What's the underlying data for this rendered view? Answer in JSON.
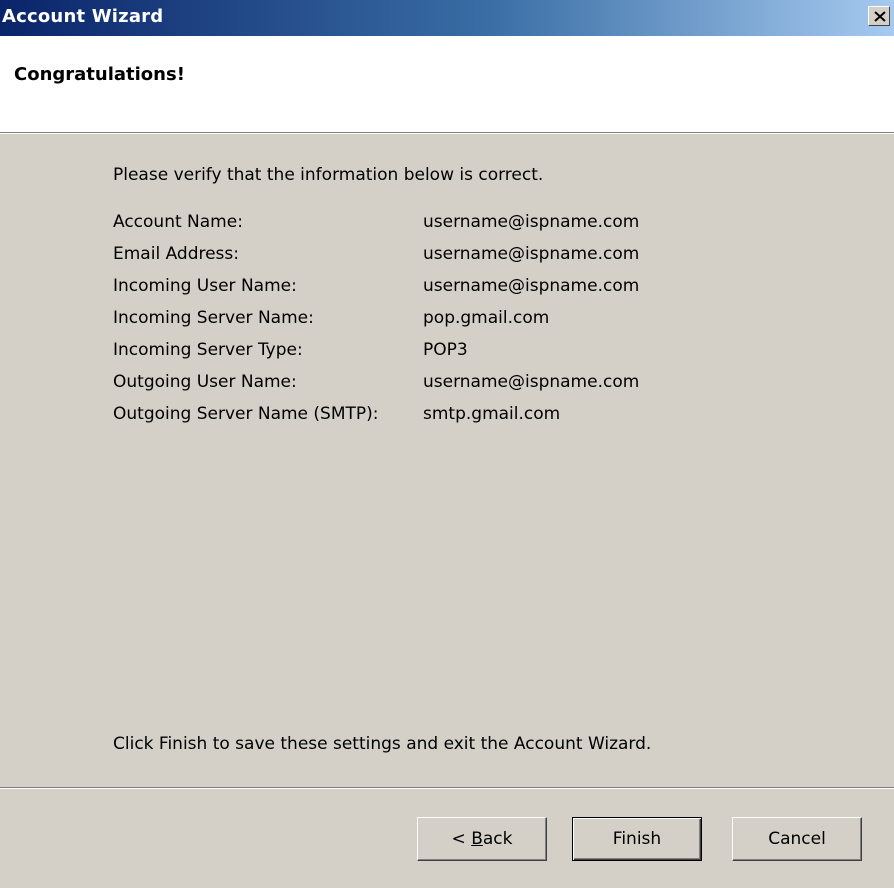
{
  "window": {
    "title": "Account Wizard"
  },
  "header": {
    "title": "Congratulations!"
  },
  "content": {
    "intro": "Please verify that the information below is correct.",
    "rows": [
      {
        "label": "Account Name:",
        "value": "username@ispname.com"
      },
      {
        "label": "Email Address:",
        "value": "username@ispname.com"
      },
      {
        "label": "Incoming User Name:",
        "value": "username@ispname.com"
      },
      {
        "label": "Incoming Server Name:",
        "value": "pop.gmail.com"
      },
      {
        "label": "Incoming Server Type:",
        "value": "POP3"
      },
      {
        "label": "Outgoing User Name:",
        "value": "username@ispname.com"
      },
      {
        "label": "Outgoing Server Name (SMTP):",
        "value": "smtp.gmail.com"
      }
    ],
    "finish_note": "Click Finish to save these settings and exit the Account Wizard."
  },
  "buttons": {
    "back_prefix": "< ",
    "back_accel": "B",
    "back_rest": "ack",
    "finish": "Finish",
    "cancel": "Cancel"
  },
  "icons": {
    "close": "close-icon"
  }
}
